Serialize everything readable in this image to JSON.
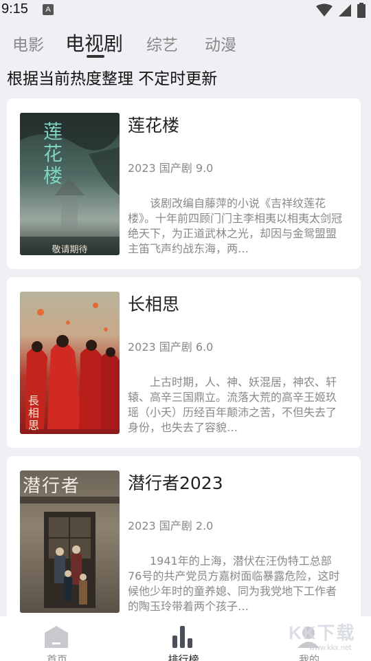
{
  "status_bar": {
    "time": "9:15",
    "notification_icon": "A"
  },
  "tabs": [
    {
      "label": "电影"
    },
    {
      "label": "电视剧",
      "active": true
    },
    {
      "label": "综艺"
    },
    {
      "label": "动漫"
    }
  ],
  "subtitle": "根据当前热度整理 不定时更新",
  "cards": [
    {
      "title": "莲花楼",
      "meta": "2023 国产剧 9.0",
      "description": "该剧改编自藤萍的小说《吉祥纹莲花楼》。十年前四顾门门主李相夷以相夷太剑冠绝天下，为正道武林之光，却因与金鸳盟盟主笛飞声约战东海，两…",
      "poster_text": "莲花楼",
      "poster_caption": "敬请期待"
    },
    {
      "title": "长相思",
      "meta": "2023 国产剧 6.0",
      "description": "上古时期，人、神、妖混居，神农、轩辕、高辛三国鼎立。流落大荒的高辛王姬玖瑶（小夭）历经百年颠沛之苦，不但失去了身份，也失去了容貌…",
      "poster_text": "長相思"
    },
    {
      "title": "潜行者2023",
      "meta": "2023 国产剧 2.0",
      "description": "1941年的上海，潜伏在汪伪特工总部76号的共产党员方嘉树面临暴露危险，这时候他少年时的童养媳、同为我党地下工作者的陶玉玲带着两个孩子…",
      "poster_text": "潜行者"
    }
  ],
  "bottom_nav": [
    {
      "label": "首页",
      "icon": "home-icon"
    },
    {
      "label": "排行榜",
      "icon": "chart-icon",
      "active": true
    },
    {
      "label": "我的",
      "icon": "user-icon"
    }
  ],
  "watermark": {
    "text": "KK下载",
    "url": "www.kkx.net"
  }
}
